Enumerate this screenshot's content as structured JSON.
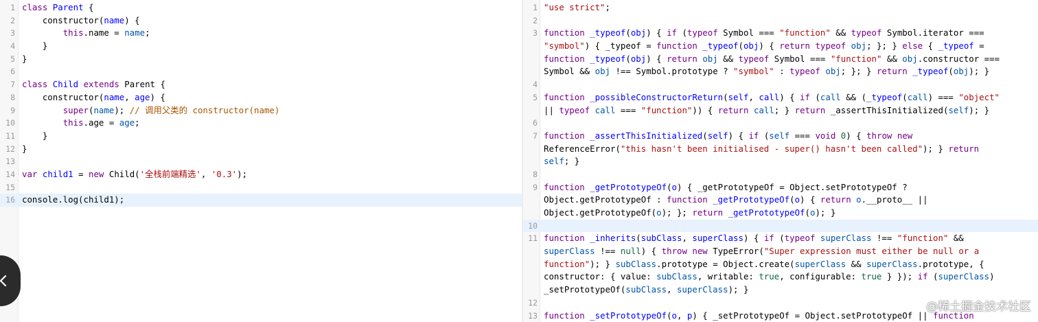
{
  "left_editor": {
    "lines": [
      {
        "n": "1",
        "tokens": [
          {
            "t": "class",
            "c": "kw"
          },
          {
            "t": " "
          },
          {
            "t": "Parent",
            "c": "def"
          },
          {
            "t": " {"
          }
        ]
      },
      {
        "n": "2",
        "tokens": [
          {
            "t": "    constructor("
          },
          {
            "t": "name",
            "c": "def"
          },
          {
            "t": ") {"
          }
        ]
      },
      {
        "n": "3",
        "tokens": [
          {
            "t": "        "
          },
          {
            "t": "this",
            "c": "kw"
          },
          {
            "t": ".name = "
          },
          {
            "t": "name",
            "c": "var2"
          },
          {
            "t": ";"
          }
        ]
      },
      {
        "n": "4",
        "tokens": [
          {
            "t": "    }"
          }
        ]
      },
      {
        "n": "5",
        "tokens": [
          {
            "t": "}"
          }
        ]
      },
      {
        "n": "6",
        "tokens": []
      },
      {
        "n": "7",
        "tokens": [
          {
            "t": "class",
            "c": "kw"
          },
          {
            "t": " "
          },
          {
            "t": "Child",
            "c": "def"
          },
          {
            "t": " "
          },
          {
            "t": "extends",
            "c": "kw"
          },
          {
            "t": " Parent {"
          }
        ]
      },
      {
        "n": "8",
        "tokens": [
          {
            "t": "    constructor("
          },
          {
            "t": "name",
            "c": "def"
          },
          {
            "t": ", "
          },
          {
            "t": "age",
            "c": "def"
          },
          {
            "t": ") {"
          }
        ]
      },
      {
        "n": "9",
        "tokens": [
          {
            "t": "        "
          },
          {
            "t": "super",
            "c": "kw"
          },
          {
            "t": "("
          },
          {
            "t": "name",
            "c": "var2"
          },
          {
            "t": "); "
          },
          {
            "t": "// 调用父类的 constructor(name)",
            "c": "cm"
          }
        ]
      },
      {
        "n": "10",
        "tokens": [
          {
            "t": "        "
          },
          {
            "t": "this",
            "c": "kw"
          },
          {
            "t": ".age = "
          },
          {
            "t": "age",
            "c": "var2"
          },
          {
            "t": ";"
          }
        ]
      },
      {
        "n": "11",
        "tokens": [
          {
            "t": "    }"
          }
        ]
      },
      {
        "n": "12",
        "tokens": [
          {
            "t": "}"
          }
        ]
      },
      {
        "n": "13",
        "tokens": []
      },
      {
        "n": "14",
        "tokens": [
          {
            "t": "var",
            "c": "kw"
          },
          {
            "t": " "
          },
          {
            "t": "child1",
            "c": "def"
          },
          {
            "t": " = "
          },
          {
            "t": "new",
            "c": "kw"
          },
          {
            "t": " Child("
          },
          {
            "t": "'全栈前端精选'",
            "c": "str"
          },
          {
            "t": ", "
          },
          {
            "t": "'0.3'",
            "c": "str"
          },
          {
            "t": ");"
          }
        ]
      },
      {
        "n": "15",
        "tokens": []
      },
      {
        "n": "16",
        "hl": true,
        "tokens": [
          {
            "t": "console.log(child1);"
          }
        ]
      }
    ]
  },
  "right_editor": {
    "lines": [
      {
        "n": "1",
        "tokens": [
          {
            "t": "\"use strict\"",
            "c": "str"
          },
          {
            "t": ";"
          }
        ]
      },
      {
        "n": "2",
        "tokens": []
      },
      {
        "n": "3",
        "tokens": [
          {
            "t": "function",
            "c": "kw"
          },
          {
            "t": " "
          },
          {
            "t": "_typeof",
            "c": "def"
          },
          {
            "t": "("
          },
          {
            "t": "obj",
            "c": "def"
          },
          {
            "t": ") { "
          },
          {
            "t": "if",
            "c": "kw"
          },
          {
            "t": " ("
          },
          {
            "t": "typeof",
            "c": "kw"
          },
          {
            "t": " Symbol === "
          },
          {
            "t": "\"function\"",
            "c": "str"
          },
          {
            "t": " && "
          },
          {
            "t": "typeof",
            "c": "kw"
          },
          {
            "t": " Symbol.iterator ==="
          }
        ]
      },
      {
        "n": "",
        "tokens": [
          {
            "t": "\"symbol\"",
            "c": "str"
          },
          {
            "t": ") { _typeof = "
          },
          {
            "t": "function",
            "c": "kw"
          },
          {
            "t": " "
          },
          {
            "t": "_typeof",
            "c": "def"
          },
          {
            "t": "("
          },
          {
            "t": "obj",
            "c": "def"
          },
          {
            "t": ") { "
          },
          {
            "t": "return",
            "c": "kw"
          },
          {
            "t": " "
          },
          {
            "t": "typeof",
            "c": "kw"
          },
          {
            "t": " "
          },
          {
            "t": "obj",
            "c": "var2"
          },
          {
            "t": "; }; } "
          },
          {
            "t": "else",
            "c": "kw"
          },
          {
            "t": " { "
          },
          {
            "t": "_typeof",
            "c": "def"
          },
          {
            "t": " ="
          }
        ]
      },
      {
        "n": "",
        "tokens": [
          {
            "t": "function",
            "c": "kw"
          },
          {
            "t": " "
          },
          {
            "t": "_typeof",
            "c": "def"
          },
          {
            "t": "("
          },
          {
            "t": "obj",
            "c": "def"
          },
          {
            "t": ") { "
          },
          {
            "t": "return",
            "c": "kw"
          },
          {
            "t": " "
          },
          {
            "t": "obj",
            "c": "var2"
          },
          {
            "t": " && "
          },
          {
            "t": "typeof",
            "c": "kw"
          },
          {
            "t": " Symbol === "
          },
          {
            "t": "\"function\"",
            "c": "str"
          },
          {
            "t": " && "
          },
          {
            "t": "obj",
            "c": "var2"
          },
          {
            "t": ".constructor ==="
          }
        ]
      },
      {
        "n": "",
        "tokens": [
          {
            "t": "Symbol && "
          },
          {
            "t": "obj",
            "c": "var2"
          },
          {
            "t": " !== Symbol.prototype ? "
          },
          {
            "t": "\"symbol\"",
            "c": "str"
          },
          {
            "t": " : "
          },
          {
            "t": "typeof",
            "c": "kw"
          },
          {
            "t": " "
          },
          {
            "t": "obj",
            "c": "var2"
          },
          {
            "t": "; }; } "
          },
          {
            "t": "return",
            "c": "kw"
          },
          {
            "t": " "
          },
          {
            "t": "_typeof",
            "c": "def"
          },
          {
            "t": "("
          },
          {
            "t": "obj",
            "c": "var2"
          },
          {
            "t": "); }"
          }
        ]
      },
      {
        "n": "4",
        "tokens": []
      },
      {
        "n": "5",
        "tokens": [
          {
            "t": "function",
            "c": "kw"
          },
          {
            "t": " "
          },
          {
            "t": "_possibleConstructorReturn",
            "c": "def"
          },
          {
            "t": "("
          },
          {
            "t": "self",
            "c": "def"
          },
          {
            "t": ", "
          },
          {
            "t": "call",
            "c": "def"
          },
          {
            "t": ") { "
          },
          {
            "t": "if",
            "c": "kw"
          },
          {
            "t": " ("
          },
          {
            "t": "call",
            "c": "var2"
          },
          {
            "t": " && ("
          },
          {
            "t": "_typeof",
            "c": "def"
          },
          {
            "t": "("
          },
          {
            "t": "call",
            "c": "var2"
          },
          {
            "t": ") === "
          },
          {
            "t": "\"object\"",
            "c": "str"
          }
        ]
      },
      {
        "n": "",
        "tokens": [
          {
            "t": "|| "
          },
          {
            "t": "typeof",
            "c": "kw"
          },
          {
            "t": " "
          },
          {
            "t": "call",
            "c": "var2"
          },
          {
            "t": " === "
          },
          {
            "t": "\"function\"",
            "c": "str"
          },
          {
            "t": ")) { "
          },
          {
            "t": "return",
            "c": "kw"
          },
          {
            "t": " "
          },
          {
            "t": "call",
            "c": "var2"
          },
          {
            "t": "; } "
          },
          {
            "t": "return",
            "c": "kw"
          },
          {
            "t": " _assertThisInitialized("
          },
          {
            "t": "self",
            "c": "var2"
          },
          {
            "t": "); }"
          }
        ]
      },
      {
        "n": "6",
        "tokens": []
      },
      {
        "n": "7",
        "tokens": [
          {
            "t": "function",
            "c": "kw"
          },
          {
            "t": " "
          },
          {
            "t": "_assertThisInitialized",
            "c": "def"
          },
          {
            "t": "("
          },
          {
            "t": "self",
            "c": "def"
          },
          {
            "t": ") { "
          },
          {
            "t": "if",
            "c": "kw"
          },
          {
            "t": " ("
          },
          {
            "t": "self",
            "c": "var2"
          },
          {
            "t": " === "
          },
          {
            "t": "void",
            "c": "kw"
          },
          {
            "t": " "
          },
          {
            "t": "0",
            "c": "num"
          },
          {
            "t": ") { "
          },
          {
            "t": "throw",
            "c": "kw"
          },
          {
            "t": " "
          },
          {
            "t": "new",
            "c": "kw"
          }
        ]
      },
      {
        "n": "",
        "tokens": [
          {
            "t": "ReferenceError("
          },
          {
            "t": "\"this hasn't been initialised - super() hasn't been called\"",
            "c": "str"
          },
          {
            "t": "); } "
          },
          {
            "t": "return",
            "c": "kw"
          }
        ]
      },
      {
        "n": "",
        "tokens": [
          {
            "t": "self",
            "c": "var2"
          },
          {
            "t": "; }"
          }
        ]
      },
      {
        "n": "8",
        "tokens": []
      },
      {
        "n": "9",
        "tokens": [
          {
            "t": "function",
            "c": "kw"
          },
          {
            "t": " "
          },
          {
            "t": "_getPrototypeOf",
            "c": "def"
          },
          {
            "t": "("
          },
          {
            "t": "o",
            "c": "def"
          },
          {
            "t": ") { _getPrototypeOf = Object.setPrototypeOf ?"
          }
        ]
      },
      {
        "n": "",
        "tokens": [
          {
            "t": "Object.getPrototypeOf : "
          },
          {
            "t": "function",
            "c": "kw"
          },
          {
            "t": " "
          },
          {
            "t": "_getPrototypeOf",
            "c": "def"
          },
          {
            "t": "("
          },
          {
            "t": "o",
            "c": "def"
          },
          {
            "t": ") { "
          },
          {
            "t": "return",
            "c": "kw"
          },
          {
            "t": " "
          },
          {
            "t": "o",
            "c": "var2"
          },
          {
            "t": ".__proto__ ||"
          }
        ]
      },
      {
        "n": "",
        "tokens": [
          {
            "t": "Object.getPrototypeOf("
          },
          {
            "t": "o",
            "c": "var2"
          },
          {
            "t": "); }; "
          },
          {
            "t": "return",
            "c": "kw"
          },
          {
            "t": " "
          },
          {
            "t": "_getPrototypeOf",
            "c": "def"
          },
          {
            "t": "("
          },
          {
            "t": "o",
            "c": "var2"
          },
          {
            "t": "); }"
          }
        ]
      },
      {
        "n": "10",
        "hl": true,
        "tokens": []
      },
      {
        "n": "11",
        "tokens": [
          {
            "t": "function",
            "c": "kw"
          },
          {
            "t": " "
          },
          {
            "t": "_inherits",
            "c": "def"
          },
          {
            "t": "("
          },
          {
            "t": "subClass",
            "c": "def"
          },
          {
            "t": ", "
          },
          {
            "t": "superClass",
            "c": "def"
          },
          {
            "t": ") { "
          },
          {
            "t": "if",
            "c": "kw"
          },
          {
            "t": " ("
          },
          {
            "t": "typeof",
            "c": "kw"
          },
          {
            "t": " "
          },
          {
            "t": "superClass",
            "c": "var2"
          },
          {
            "t": " !== "
          },
          {
            "t": "\"function\"",
            "c": "str"
          },
          {
            "t": " &&"
          }
        ]
      },
      {
        "n": "",
        "tokens": [
          {
            "t": "superClass",
            "c": "var2"
          },
          {
            "t": " !== "
          },
          {
            "t": "null",
            "c": "num"
          },
          {
            "t": ") { "
          },
          {
            "t": "throw",
            "c": "kw"
          },
          {
            "t": " "
          },
          {
            "t": "new",
            "c": "kw"
          },
          {
            "t": " TypeError("
          },
          {
            "t": "\"Super expression must either be null or a",
            "c": "str"
          }
        ]
      },
      {
        "n": "",
        "tokens": [
          {
            "t": "function\"",
            "c": "str"
          },
          {
            "t": "); } "
          },
          {
            "t": "subClass",
            "c": "var2"
          },
          {
            "t": ".prototype = Object.create("
          },
          {
            "t": "superClass",
            "c": "var2"
          },
          {
            "t": " && "
          },
          {
            "t": "superClass",
            "c": "var2"
          },
          {
            "t": ".prototype, {"
          }
        ]
      },
      {
        "n": "",
        "tokens": [
          {
            "t": "constructor: { value: "
          },
          {
            "t": "subClass",
            "c": "var2"
          },
          {
            "t": ", writable: "
          },
          {
            "t": "true",
            "c": "num"
          },
          {
            "t": ", configurable: "
          },
          {
            "t": "true",
            "c": "num"
          },
          {
            "t": " } }); "
          },
          {
            "t": "if",
            "c": "kw"
          },
          {
            "t": " ("
          },
          {
            "t": "superClass",
            "c": "var2"
          },
          {
            "t": ")"
          }
        ]
      },
      {
        "n": "",
        "tokens": [
          {
            "t": "_setPrototypeOf("
          },
          {
            "t": "subClass",
            "c": "var2"
          },
          {
            "t": ", "
          },
          {
            "t": "superClass",
            "c": "var2"
          },
          {
            "t": "); }"
          }
        ]
      },
      {
        "n": "12",
        "tokens": []
      },
      {
        "n": "13",
        "tokens": [
          {
            "t": "function",
            "c": "kw"
          },
          {
            "t": " "
          },
          {
            "t": "_setPrototypeOf",
            "c": "def"
          },
          {
            "t": "("
          },
          {
            "t": "o",
            "c": "def"
          },
          {
            "t": ", "
          },
          {
            "t": "p",
            "c": "def"
          },
          {
            "t": ") { _setPrototypeOf = Object.setPrototypeOf || "
          },
          {
            "t": "function",
            "c": "kw"
          }
        ]
      }
    ]
  },
  "back_button": {
    "icon": "chevron-left-icon"
  },
  "watermark": {
    "text": "@稀土掘金技术社区"
  },
  "colors": {
    "keyword": "#770088",
    "definition": "#0000ff",
    "string": "#aa1111",
    "number": "#116644",
    "comment": "#aa5500",
    "variable": "#0055aa",
    "active_line": "#e8f2fe"
  }
}
